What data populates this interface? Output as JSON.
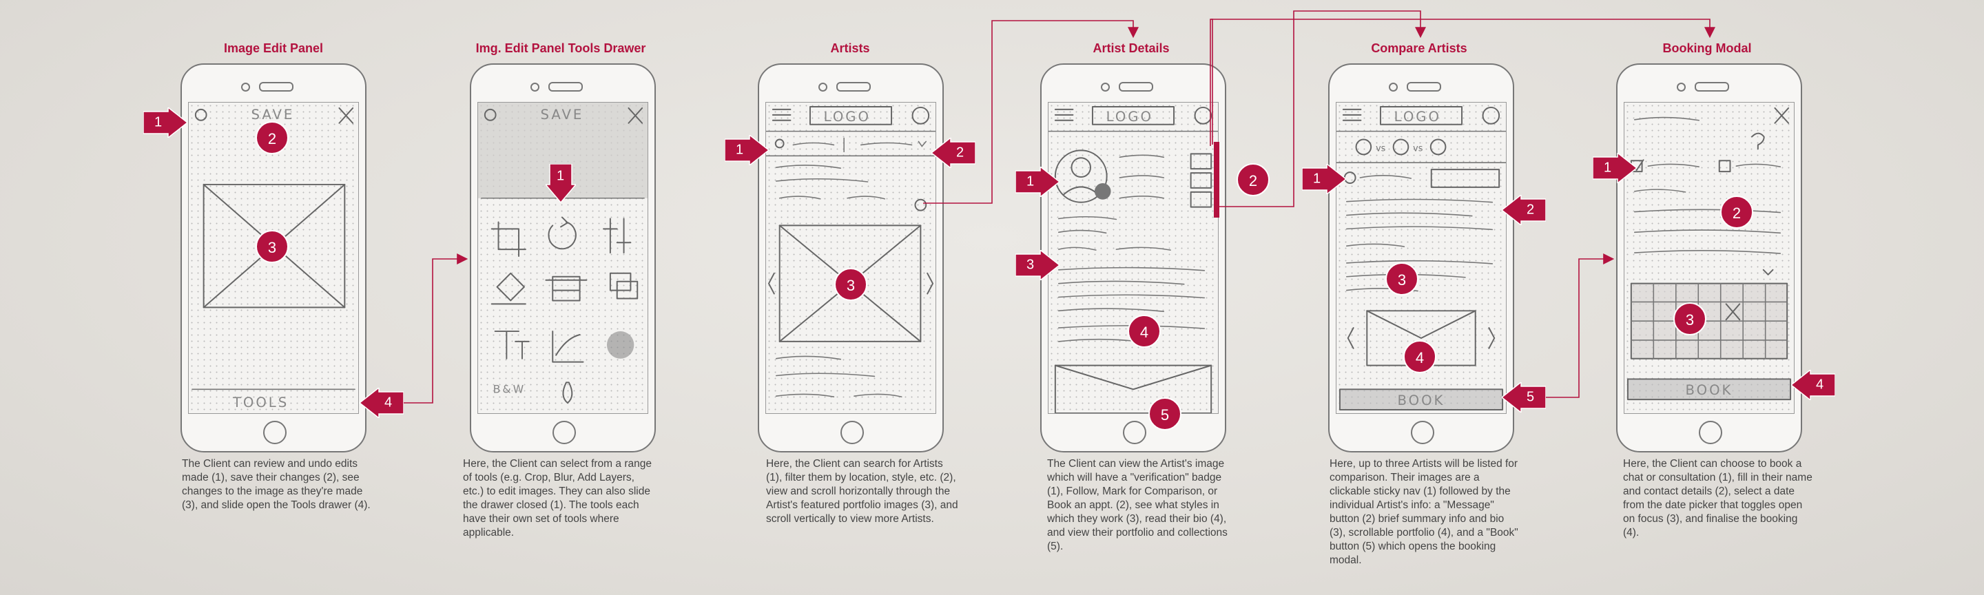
{
  "panels": [
    {
      "title": "Image Edit Panel",
      "sketch_text": "SAVE",
      "footer_text": "TOOLS",
      "description": "The Client can review and undo edits made (1), save their changes (2), see changes to the image as they're made (3), and slide open the Tools drawer (4)."
    },
    {
      "title": "Img. Edit Panel Tools Drawer",
      "sketch_text": "SAVE",
      "tool_text": "B&W",
      "description": "Here, the Client can select from a range of tools (e.g. Crop, Blur, Add Layers, etc.) to edit images. They can also slide the drawer closed (1). The tools each have their own set of tools where applicable."
    },
    {
      "title": "Artists",
      "logo_text": "LOGO",
      "description": "Here, the Client can search for Artists (1), filter them by location, style, etc. (2), view and scroll horizontally through the Artist's featured portfolio images (3), and scroll vertically to view more Artists."
    },
    {
      "title": "Artist Details",
      "logo_text": "LOGO",
      "description": "The Client can view the Artist's image which will have a \"verification\" badge (1), Follow, Mark for Comparison, or Book an appt. (2), see what styles in which they work (3), read their bio (4), and view their portfolio and collections (5)."
    },
    {
      "title": "Compare Artists",
      "logo_text": "LOGO",
      "vs_text": "vs",
      "book_text": "BOOK",
      "description": "Here, up to three Artists will be listed for comparison. Their images are a clickable sticky nav (1) followed by the individual Artist's info: a \"Message\" button (2) brief summary info and bio (3), scrollable portfolio (4), and a \"Book\" button (5) which opens the booking modal."
    },
    {
      "title": "Booking Modal",
      "book_text": "BOOK",
      "description": "Here, the Client can choose to book a chat or consultation (1), fill in their name and contact details (2), select a date from the date picker that toggles open on focus (3), and finalise the booking (4)."
    }
  ],
  "markers": {
    "p1": [
      "1",
      "2",
      "3",
      "4"
    ],
    "p2": [
      "1"
    ],
    "p3": [
      "1",
      "2",
      "3"
    ],
    "p4": [
      "1",
      "2",
      "3",
      "4",
      "5"
    ],
    "p5": [
      "1",
      "2",
      "3",
      "4",
      "5"
    ],
    "p6": [
      "1",
      "2",
      "3",
      "4"
    ]
  },
  "colors": {
    "accent": "#b3123f",
    "sketch": "#666666",
    "text": "#444444"
  }
}
